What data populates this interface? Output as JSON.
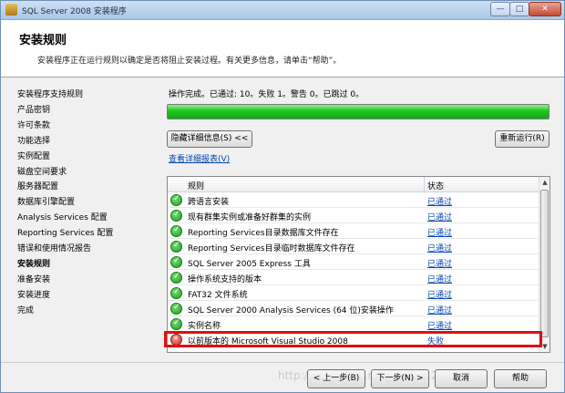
{
  "window": {
    "title": "SQL Server 2008 安装程序",
    "controls": {
      "minimize": "—",
      "maximize": "□",
      "close": "✕"
    }
  },
  "header": {
    "title": "安装规则",
    "description": "安装程序正在运行规则以确定是否将阻止安装过程。有关更多信息，请单击“帮助”。"
  },
  "sidebar": {
    "items": [
      {
        "label": "安装程序支持规则",
        "active": false
      },
      {
        "label": "产品密钥",
        "active": false
      },
      {
        "label": "许可条款",
        "active": false
      },
      {
        "label": "功能选择",
        "active": false
      },
      {
        "label": "实例配置",
        "active": false
      },
      {
        "label": "磁盘空间要求",
        "active": false
      },
      {
        "label": "服务器配置",
        "active": false
      },
      {
        "label": "数据库引擎配置",
        "active": false
      },
      {
        "label": "Analysis Services 配置",
        "active": false
      },
      {
        "label": "Reporting Services 配置",
        "active": false
      },
      {
        "label": "错误和使用情况报告",
        "active": false
      },
      {
        "label": "安装规则",
        "active": true
      },
      {
        "label": "准备安装",
        "active": false
      },
      {
        "label": "安装进度",
        "active": false
      },
      {
        "label": "完成",
        "active": false
      }
    ]
  },
  "main": {
    "status_text": "操作完成。已通过: 10。失败 1。警告 0。已跳过 0。",
    "progress": 1.0,
    "hide_details_label": "隐藏详细信息(S) <<",
    "rerun_label": "重新运行(R)",
    "report_link": "查看详细报表(V)",
    "table": {
      "headers": {
        "rule": "规则",
        "status": "状态"
      },
      "rows": [
        {
          "rule": "跨语言安装",
          "status": "已通过",
          "result": "pass"
        },
        {
          "rule": "现有群集实例或准备好群集的实例",
          "status": "已通过",
          "result": "pass"
        },
        {
          "rule": "Reporting Services目录数据库文件存在",
          "status": "已通过",
          "result": "pass"
        },
        {
          "rule": "Reporting Services目录临时数据库文件存在",
          "status": "已通过",
          "result": "pass"
        },
        {
          "rule": "SQL Server 2005 Express 工具",
          "status": "已通过",
          "result": "pass"
        },
        {
          "rule": "操作系统支持的版本",
          "status": "已通过",
          "result": "pass"
        },
        {
          "rule": "FAT32 文件系统",
          "status": "已通过",
          "result": "pass"
        },
        {
          "rule": "SQL Server 2000 Analysis Services (64 位)安装操作",
          "status": "已通过",
          "result": "pass"
        },
        {
          "rule": "实例名称",
          "status": "已通过",
          "result": "pass"
        },
        {
          "rule": "以前版本的 Microsoft Visual Studio 2008",
          "status": "失败",
          "result": "fail"
        }
      ]
    }
  },
  "footer": {
    "back_label": "< 上一步(B)",
    "next_label": "下一步(N) >",
    "cancel_label": "取消",
    "help_label": "帮助"
  },
  "watermark": "http://blog.csdn.net/u0970121"
}
